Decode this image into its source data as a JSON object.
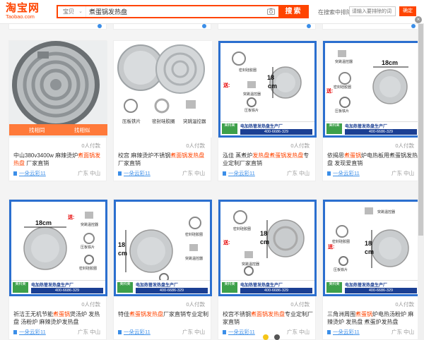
{
  "header": {
    "logo_main": "淘宝网",
    "logo_sub": "Taobao.com",
    "search_type": "宝贝",
    "search_value": "煮蛋锅发热盘",
    "search_button": "搜索",
    "rank_label": "在搜索中排除",
    "rank_placeholder": "请输入要排除的词",
    "rank_button": "确定"
  },
  "overlay": {
    "left": "找相同",
    "right": "找相似"
  },
  "banner": {
    "brand": "美科美",
    "title": "电加热管发热盘生产厂",
    "phone": "400-6686-329",
    "site": "MKMQQ.COM"
  },
  "products": [
    {
      "price": "",
      "paid": "0人付款",
      "title_pre": "中山380v3400w 麻辣烫炉",
      "title_hl": "煮面锅发热盘",
      "title_post": " 厂家直销",
      "shop": "一朵云彩11",
      "loc": "广东 中山"
    },
    {
      "price": "",
      "paid": "0人付款",
      "title_pre": "校宫 麻辣烫炉不锈钢",
      "title_hl": "煮面锅发热盘",
      "title_post": "厂家直销",
      "shop": "一朵云彩11",
      "loc": "广东 中山"
    },
    {
      "price": "",
      "paid": "0人付款",
      "title_pre": "泓佳 蒸煮炉",
      "title_hl": "发热盘煮蛋锅发热盘",
      "title_post": "专业定制厂家直销",
      "shop": "一朵云彩11",
      "loc": "广东 中山"
    },
    {
      "price": "",
      "paid": "0人付款",
      "title_pre": "依揭思",
      "title_hl": "煮蛋锅",
      "title_post": "炉电热板用煮蛋锅发热盘 发现爱直销",
      "shop": "一朵云彩11",
      "loc": "广东 中山"
    },
    {
      "price": "",
      "paid": "0人付款",
      "title_pre": "祈洁王无机节能",
      "title_hl": "煮蛋锅",
      "title_post": "煲汤炉 发热盘 汤粉炉 麻辣烫炉发热盘",
      "shop": "一朵云彩11",
      "loc": "广东 中山"
    },
    {
      "price": "",
      "paid": "0人付款",
      "title_pre": "特佳",
      "title_hl": "煮蛋锅发热盘",
      "title_post": "厂家直销专业定制",
      "shop": "一朵云彩11",
      "loc": "广东 中山"
    },
    {
      "price": "",
      "paid": "0人付款",
      "title_pre": "校宫不锈钢",
      "title_hl": "煮面锅发热盘",
      "title_post": "专业定制厂家直销",
      "shop": "一朵云彩11",
      "loc": "广东 中山"
    },
    {
      "price": "",
      "paid": "0人付款",
      "title_pre": "三角洲周围",
      "title_hl": "煮蛋锅",
      "title_post": "炉电热汤粉炉 麻辣烫炉 发热盘 煮蛋炉发热盘",
      "shop": "一朵云彩11",
      "loc": "广东 中山"
    }
  ],
  "labels": {
    "pressure": "压板铁片",
    "seal": "密封硅胶圈",
    "thermo": "突跳温控器",
    "size": "18cm",
    "gift": "送:"
  }
}
